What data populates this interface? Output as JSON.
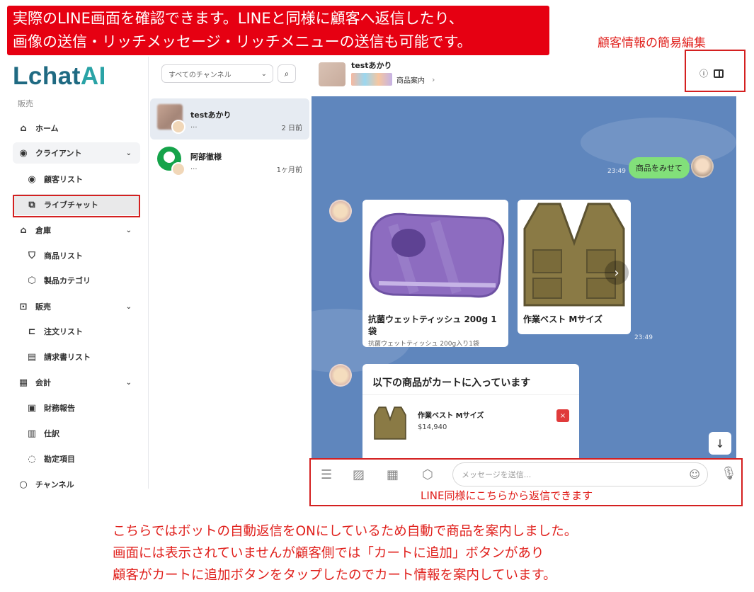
{
  "annotations": {
    "top_banner": [
      "実際のLINE画面を確認できます。LINEと同様に顧客へ返信したり、",
      "画像の送信・リッチメッセージ・リッチメニューの送信も可能です。"
    ],
    "customer_edit": "顧客情報の簡易編集",
    "reply_hint": "LINE同様にこちらから返信できます",
    "bottom_note": [
      "こちらではボットの自動返信をONにしているため自動で商品を案内しました。",
      "画面には表示されていませんが顧客側では「カートに追加」ボタンがあり",
      "顧客がカートに追加ボタンをタップしたのでカート情報を案内しています。"
    ],
    "highlight_color": "#d42020",
    "banner_color": "#e60012"
  },
  "sidebar": {
    "logo_main": "Lchat",
    "logo_accent": "AI",
    "section": "販売",
    "items": [
      {
        "label": "ホーム",
        "icon": "home-icon"
      },
      {
        "label": "クライアント",
        "icon": "user-circle-icon"
      },
      {
        "label": "顧客リスト",
        "icon": "user-circle-icon"
      },
      {
        "label": "ライブチャット",
        "icon": "chat-icon"
      },
      {
        "label": "倉庫",
        "icon": "warehouse-icon"
      },
      {
        "label": "商品リスト",
        "icon": "shirt-icon"
      },
      {
        "label": "製品カテゴリ",
        "icon": "box-icon"
      },
      {
        "label": "販売",
        "icon": "basket-icon"
      },
      {
        "label": "注文リスト",
        "icon": "cart-icon"
      },
      {
        "label": "請求書リスト",
        "icon": "invoice-icon"
      },
      {
        "label": "会計",
        "icon": "ledger-icon"
      },
      {
        "label": "財務報告",
        "icon": "report-icon"
      },
      {
        "label": "仕訳",
        "icon": "journal-icon"
      },
      {
        "label": "勘定項目",
        "icon": "account-icon"
      },
      {
        "label": "チャンネル",
        "icon": "channel-icon"
      }
    ]
  },
  "channels": {
    "filter": "すべてのチャンネル",
    "conversations": [
      {
        "name": "testあかり",
        "preview": "...",
        "time": "2 日前"
      },
      {
        "name": "阿部徹様",
        "preview": "...",
        "time": "1ヶ月前"
      }
    ]
  },
  "chat": {
    "header_name": "testあかり",
    "rich_menu_label": "商品案内",
    "user_message": "商品をみせて",
    "user_time": "23:49",
    "products": [
      {
        "title": "抗菌ウェットティッシュ 200g 1袋",
        "desc": "抗菌ウェットティッシュ 200g入り1袋"
      },
      {
        "title": "作業ベスト Mサイズ",
        "desc": ""
      }
    ],
    "carousel_time": "23:49",
    "cart_header": "以下の商品がカートに入っています",
    "cart_item_name": "作業ベスト Mサイズ",
    "cart_item_price": "$14,940",
    "background": "#5f86bd",
    "bubble_color": "#82e07a"
  },
  "input": {
    "placeholder": "メッセージを送信..."
  }
}
